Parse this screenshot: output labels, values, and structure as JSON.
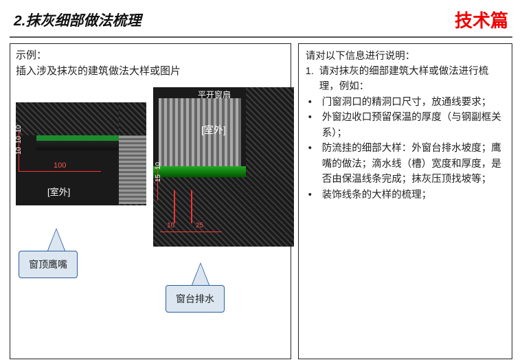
{
  "header": {
    "title": "2.抹灰细部做法梳理",
    "tag": "技术篇"
  },
  "left": {
    "example_label": "示例：",
    "example_desc": "插入涉及抹灰的建筑做法大样或图片",
    "diagram1": {
      "room_label": "[室外]",
      "dim_v1": "10",
      "dim_v2": "10",
      "dim_v3": "10",
      "dim_h": "100",
      "callout": "窗顶鹰嘴"
    },
    "diagram2": {
      "window_type": "平开窗扇",
      "room_label": "[室外]",
      "dim_v1": "10",
      "dim_v2": "15",
      "dim_h1": "10",
      "dim_h2": "25",
      "callout": "窗台排水"
    }
  },
  "right": {
    "heading": "请对以下信息进行说明：",
    "item1_num": "1.",
    "item1": "请对抹灰的细部建筑大样或做法进行梳理，例如：",
    "b1": "门窗洞口的精洞口尺寸，放通线要求；",
    "b2": "外窗边收口预留保温的厚度（与钢副框关系）；",
    "b3": "防流挂的细部大样：外窗台排水坡度；鹰嘴的做法；滴水线（槽）宽度和厚度，是否由保温线条完成；抹灰压顶找坡等；",
    "b4": "装饰线条的大样的梳理；"
  }
}
